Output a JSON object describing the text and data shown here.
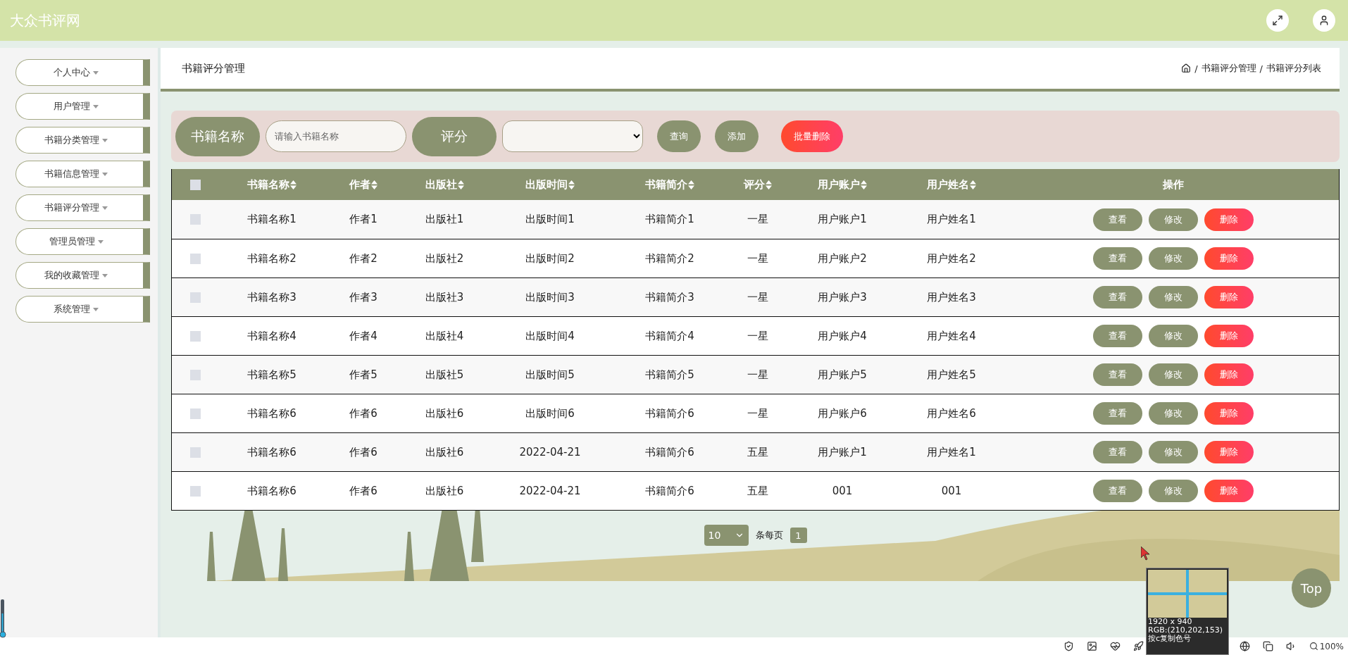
{
  "site_title": "大众书评网",
  "sidebar": {
    "items": [
      {
        "label": "个人中心"
      },
      {
        "label": "用户管理"
      },
      {
        "label": "书籍分类管理"
      },
      {
        "label": "书籍信息管理"
      },
      {
        "label": "书籍评分管理"
      },
      {
        "label": "管理员管理"
      },
      {
        "label": "我的收藏管理"
      },
      {
        "label": "系统管理"
      }
    ]
  },
  "page_header": {
    "title": "书籍评分管理",
    "separator": "/",
    "breadcrumb": [
      "书籍评分管理",
      "书籍评分列表"
    ]
  },
  "search": {
    "fields": [
      {
        "label": "书籍名称",
        "kind": "text",
        "placeholder": "请输入书籍名称"
      },
      {
        "label": "评分",
        "kind": "select"
      }
    ],
    "buttons": [
      {
        "label": "查询",
        "kind": "primary"
      },
      {
        "label": "添加",
        "kind": "primary"
      },
      {
        "label": "批量删除",
        "kind": "danger"
      }
    ]
  },
  "table": {
    "select_all_checked": false,
    "columns": [
      {
        "label": "书籍名称",
        "sortable": true
      },
      {
        "label": "作者",
        "sortable": true
      },
      {
        "label": "出版社",
        "sortable": true
      },
      {
        "label": "出版时间",
        "sortable": true
      },
      {
        "label": "书籍简介",
        "sortable": true
      },
      {
        "label": "评分",
        "sortable": true
      },
      {
        "label": "用户账户",
        "sortable": true
      },
      {
        "label": "用户姓名",
        "sortable": true
      },
      {
        "label": "操作",
        "sortable": false
      }
    ],
    "rows": [
      {
        "checked": false,
        "cells": [
          "书籍名称1",
          "作者1",
          "出版社1",
          "出版时间1",
          "书籍简介1",
          "一星",
          "用户账户1",
          "用户姓名1"
        ],
        "actions": [
          {
            "label": "查看",
            "kind": "primary"
          },
          {
            "label": "修改",
            "kind": "primary"
          },
          {
            "label": "删除",
            "kind": "danger"
          }
        ]
      },
      {
        "checked": false,
        "cells": [
          "书籍名称2",
          "作者2",
          "出版社2",
          "出版时间2",
          "书籍简介2",
          "一星",
          "用户账户2",
          "用户姓名2"
        ],
        "actions": [
          {
            "label": "查看",
            "kind": "primary"
          },
          {
            "label": "修改",
            "kind": "primary"
          },
          {
            "label": "删除",
            "kind": "danger"
          }
        ]
      },
      {
        "checked": false,
        "cells": [
          "书籍名称3",
          "作者3",
          "出版社3",
          "出版时间3",
          "书籍简介3",
          "一星",
          "用户账户3",
          "用户姓名3"
        ],
        "actions": [
          {
            "label": "查看",
            "kind": "primary"
          },
          {
            "label": "修改",
            "kind": "primary"
          },
          {
            "label": "删除",
            "kind": "danger"
          }
        ]
      },
      {
        "checked": false,
        "cells": [
          "书籍名称4",
          "作者4",
          "出版社4",
          "出版时间4",
          "书籍简介4",
          "一星",
          "用户账户4",
          "用户姓名4"
        ],
        "actions": [
          {
            "label": "查看",
            "kind": "primary"
          },
          {
            "label": "修改",
            "kind": "primary"
          },
          {
            "label": "删除",
            "kind": "danger"
          }
        ]
      },
      {
        "checked": false,
        "cells": [
          "书籍名称5",
          "作者5",
          "出版社5",
          "出版时间5",
          "书籍简介5",
          "一星",
          "用户账户5",
          "用户姓名5"
        ],
        "actions": [
          {
            "label": "查看",
            "kind": "primary"
          },
          {
            "label": "修改",
            "kind": "primary"
          },
          {
            "label": "删除",
            "kind": "danger"
          }
        ]
      },
      {
        "checked": false,
        "cells": [
          "书籍名称6",
          "作者6",
          "出版社6",
          "出版时间6",
          "书籍简介6",
          "一星",
          "用户账户6",
          "用户姓名6"
        ],
        "actions": [
          {
            "label": "查看",
            "kind": "primary"
          },
          {
            "label": "修改",
            "kind": "primary"
          },
          {
            "label": "删除",
            "kind": "danger"
          }
        ]
      },
      {
        "checked": false,
        "cells": [
          "书籍名称6",
          "作者6",
          "出版社6",
          "2022-04-21",
          "书籍简介6",
          "五星",
          "用户账户1",
          "用户姓名1"
        ],
        "actions": [
          {
            "label": "查看",
            "kind": "primary"
          },
          {
            "label": "修改",
            "kind": "primary"
          },
          {
            "label": "删除",
            "kind": "danger"
          }
        ]
      },
      {
        "checked": false,
        "cells": [
          "书籍名称6",
          "作者6",
          "出版社6",
          "2022-04-21",
          "书籍简介6",
          "五星",
          "001",
          "001"
        ],
        "actions": [
          {
            "label": "查看",
            "kind": "primary"
          },
          {
            "label": "修改",
            "kind": "primary"
          },
          {
            "label": "删除",
            "kind": "danger"
          }
        ]
      }
    ]
  },
  "pagination": {
    "page_size": "10",
    "page_size_label": "条每页",
    "pages": [
      {
        "label": "1",
        "selected": true
      }
    ]
  },
  "top_button": "Top",
  "color_picker": {
    "size": "1920 x 940",
    "rgb": "RGB:(210,202,153)",
    "hint": "按c复制色号"
  },
  "status_bar": {
    "zoom": "100%"
  }
}
